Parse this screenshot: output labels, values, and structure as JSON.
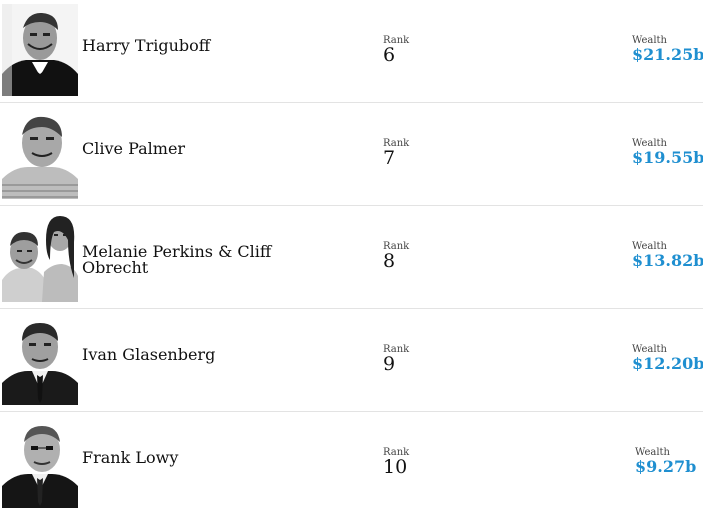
{
  "labels": {
    "rank": "Rank",
    "wealth": "Wealth"
  },
  "colors": {
    "wealth_value": "#1f8fd0",
    "divider": "#e3e3e3"
  },
  "people": [
    {
      "name": "Harry Triguboff",
      "rank": "6",
      "wealth": "$21.25b",
      "portrait_icon": "person-portrait-icon"
    },
    {
      "name": "Clive Palmer",
      "rank": "7",
      "wealth": "$19.55b",
      "portrait_icon": "person-portrait-icon"
    },
    {
      "name": "Melanie Perkins & Cliff Obrecht",
      "rank": "8",
      "wealth": "$13.82b",
      "portrait_icon": "couple-portrait-icon"
    },
    {
      "name": "Ivan Glasenberg",
      "rank": "9",
      "wealth": "$12.20b",
      "portrait_icon": "person-portrait-icon"
    },
    {
      "name": "Frank Lowy",
      "rank": "10",
      "wealth": "$9.27b",
      "portrait_icon": "person-portrait-icon"
    }
  ]
}
